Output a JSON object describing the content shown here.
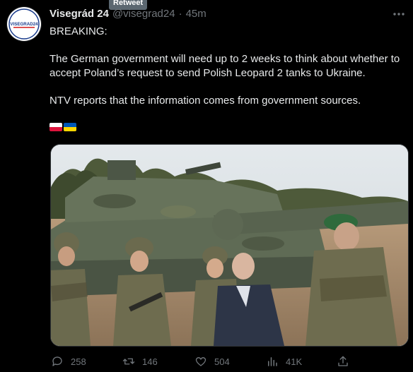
{
  "tooltip": "Retweet",
  "author": {
    "display_name": "Visegrád 24",
    "handle": "@visegrad24",
    "separator": "·",
    "time": "45m",
    "avatar_text": "VISEGRAD24"
  },
  "tweet": {
    "line1": "BREAKING:",
    "paragraph1": "The German government will need up to 2 weeks to think about whether to accept Poland’s request to send Polish Leopard 2 tanks to Ukraine.",
    "paragraph2": "NTV reports that the information comes from government sources.",
    "flags": [
      "flag-poland-icon",
      "flag-ukraine-icon"
    ]
  },
  "media": {
    "description_icon": "photo",
    "colors": {
      "sky": "#d8dee3",
      "tank": "#5f6b55",
      "camo": "#6b6a4e",
      "suit": "#2d3547"
    }
  },
  "actions": {
    "replies": "258",
    "retweets": "146",
    "likes": "504",
    "views": "41K"
  },
  "colors": {
    "background": "#000000",
    "text": "#e7e9ea",
    "muted": "#71767b",
    "tooltip": "#5b6770"
  }
}
